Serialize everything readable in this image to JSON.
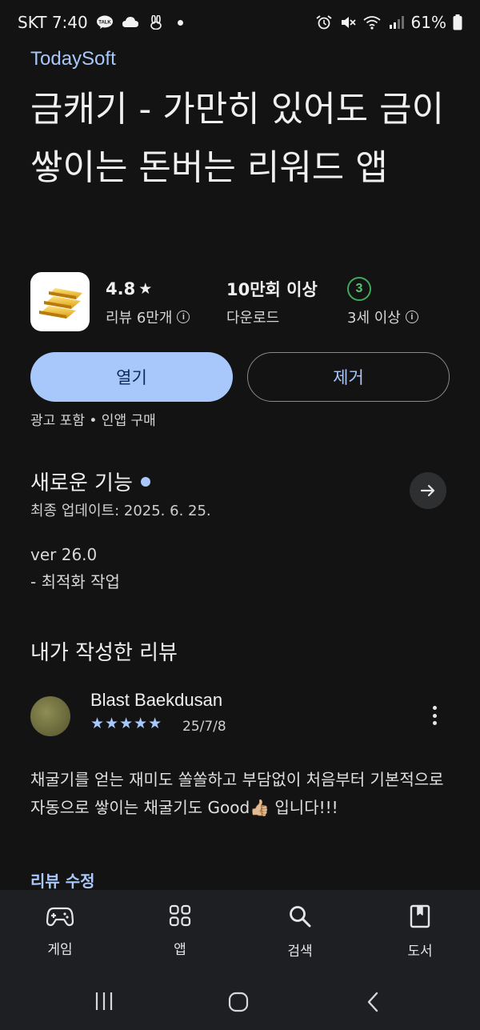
{
  "status_bar": {
    "carrier_time": "SKT 7:40",
    "talk_badge": "TALK",
    "battery": "61%"
  },
  "app": {
    "developer": "TodaySoft",
    "title": "금캐기 - 가만히 있어도 금이 쌓이는 돈버는 리워드 앱",
    "rating": "4.8",
    "rating_star": "★",
    "reviews_label": "리뷰 6만개",
    "downloads_value": "10만회 이상",
    "downloads_label": "다운로드",
    "age_rating_number": "3",
    "age_rating_label": "3세 이상"
  },
  "actions": {
    "open_label": "열기",
    "remove_label": "제거",
    "ads_note": "광고 포함 • 인앱 구매"
  },
  "whats_new": {
    "title": "새로운 기능",
    "updated": "최종 업데이트: 2025. 6. 25.",
    "version": "ver 26.0",
    "notes": "- 최적화 작업"
  },
  "my_review": {
    "section_title": "내가 작성한 리뷰",
    "reviewer_name": "Blast Baekdusan",
    "stars": "★★★★★",
    "star_count": 5,
    "date": "25/7/8",
    "text": "채굴기를 얻는 재미도 쏠쏠하고 부담없이 처음부터 기본적으로 자동으로 쌓이는 채굴기도 Good👍🏼 입니다!!!",
    "edit_label": "리뷰 수정"
  },
  "bottom_nav": {
    "items": [
      {
        "label": "게임",
        "icon": "gamepad-icon"
      },
      {
        "label": "앱",
        "icon": "apps-grid-icon"
      },
      {
        "label": "검색",
        "icon": "search-icon"
      },
      {
        "label": "도서",
        "icon": "book-icon"
      }
    ]
  },
  "colors": {
    "background": "#131313",
    "accent": "#a8c7fa",
    "open_button_text": "#0b2a57",
    "age_badge": "#3fa85b"
  }
}
